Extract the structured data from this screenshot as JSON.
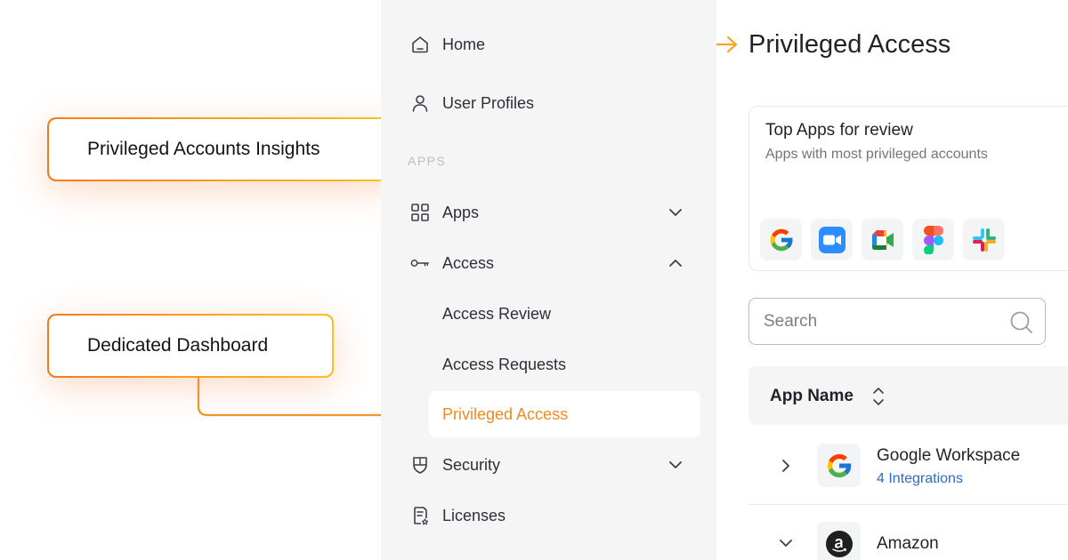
{
  "colors": {
    "accent": "#f28a1f",
    "accent_end": "#f9c123",
    "link": "#2b6bc4",
    "sidebar_bg": "#f5f5f6"
  },
  "callouts": [
    {
      "label": "Privileged Accounts Insights"
    },
    {
      "label": "Dedicated Dashboard"
    }
  ],
  "sidebar": {
    "section_label": "APPS",
    "items": [
      {
        "label": "Home",
        "icon": "home-icon"
      },
      {
        "label": "User Profiles",
        "icon": "user-icon"
      },
      {
        "label": "Apps",
        "icon": "grid-icon",
        "expanded": false
      },
      {
        "label": "Access",
        "icon": "key-icon",
        "expanded": true
      },
      {
        "label": "Access Review"
      },
      {
        "label": "Access Requests"
      },
      {
        "label": "Privileged Access",
        "active": true
      },
      {
        "label": "Security",
        "icon": "shield-icon",
        "expanded": false
      },
      {
        "label": "Licenses",
        "icon": "license-icon"
      }
    ]
  },
  "main": {
    "title": "Privileged Access",
    "top_apps": {
      "title": "Top Apps for review",
      "subtitle": "Apps with most privileged accounts",
      "apps": [
        "google-icon",
        "zoom-icon",
        "google-meet-icon",
        "figma-icon",
        "slack-icon"
      ]
    },
    "search": {
      "placeholder": "Search",
      "value": ""
    },
    "table": {
      "column_header": "App Name",
      "rows": [
        {
          "name": "Google Workspace",
          "meta": "4 Integrations",
          "expanded": false,
          "logo": "google-icon"
        },
        {
          "name": "Amazon",
          "expanded": true,
          "logo": "amazon-icon"
        }
      ]
    }
  }
}
